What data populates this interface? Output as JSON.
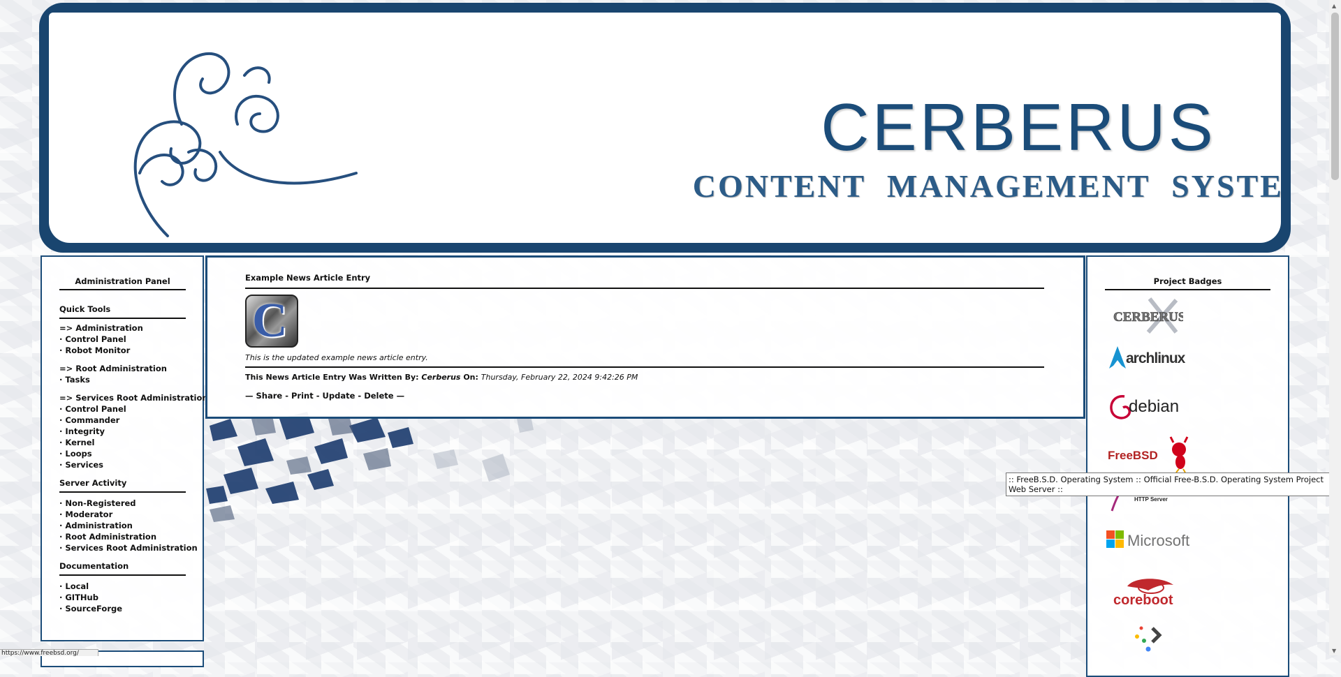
{
  "banner": {
    "title": "CERBERUS",
    "subtitle": "CONTENT MANAGEMENT SYSTEM"
  },
  "left_sidebar": {
    "title": "Administration Panel",
    "quick_tools": {
      "heading": "Quick Tools",
      "groups": [
        {
          "header": "=> Administration",
          "items": [
            "· Control Panel",
            "· Robot Monitor"
          ]
        },
        {
          "header": "=> Root Administration",
          "items": [
            "· Tasks"
          ]
        },
        {
          "header": "=> Services Root Administration",
          "items": [
            "· Control Panel",
            "· Commander",
            "· Integrity",
            "· Kernel",
            "· Loops",
            "· Services"
          ]
        }
      ]
    },
    "server_activity": {
      "heading": "Server Activity",
      "items": [
        "· Non-Registered",
        "· Moderator",
        "· Administration",
        "· Root Administration",
        "· Services Root Administration"
      ]
    },
    "documentation": {
      "heading": "Documentation",
      "items": [
        "· Local",
        "· GITHub",
        "· SourceForge"
      ]
    }
  },
  "article": {
    "title": "Example News Article Entry",
    "body": "This is the updated example news article entry.",
    "meta_prefix": "This News Article Entry Was Written By:",
    "author": "Cerberus",
    "meta_on": "On:",
    "date": "Thursday, February 22, 2024 9:42:26 PM",
    "actions": [
      "— Share -",
      "Print -",
      "Update -",
      "Delete —"
    ]
  },
  "right_sidebar": {
    "title": "Project Badges",
    "badges": [
      {
        "label": "CERBERUS",
        "icon": "cerberus-logo-icon"
      },
      {
        "label": "archlinux",
        "icon": "archlinux-logo-icon"
      },
      {
        "label": "debian",
        "icon": "debian-logo-icon"
      },
      {
        "label": "FreeBSD",
        "icon": "freebsd-logo-icon"
      },
      {
        "label": "HTTP Server",
        "icon": "apache-logo-icon"
      },
      {
        "label": "Microsoft",
        "icon": "microsoft-logo-icon"
      },
      {
        "label": "coreboot",
        "icon": "coreboot-logo-icon"
      },
      {
        "label": "",
        "icon": "dots-arrow-logo-icon"
      }
    ]
  },
  "tooltip": ":: FreeB.S.D. Operating System :: Official Free-B.S.D. Operating System Project Web Server ::",
  "statusbar": "https://www.freebsd.org/"
}
